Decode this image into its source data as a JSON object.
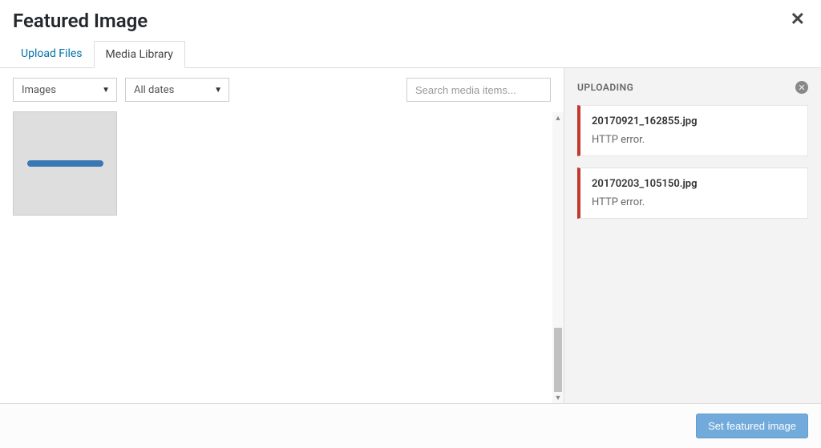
{
  "modal": {
    "title": "Featured Image"
  },
  "tabs": {
    "upload": "Upload Files",
    "library": "Media Library"
  },
  "filters": {
    "type": "Images",
    "date": "All dates"
  },
  "search": {
    "placeholder": "Search media items..."
  },
  "sidebar": {
    "title": "UPLOADING",
    "uploads": [
      {
        "filename": "20170921_162855.jpg",
        "error": "HTTP error."
      },
      {
        "filename": "20170203_105150.jpg",
        "error": "HTTP error."
      }
    ]
  },
  "footer": {
    "set_button": "Set featured image"
  }
}
